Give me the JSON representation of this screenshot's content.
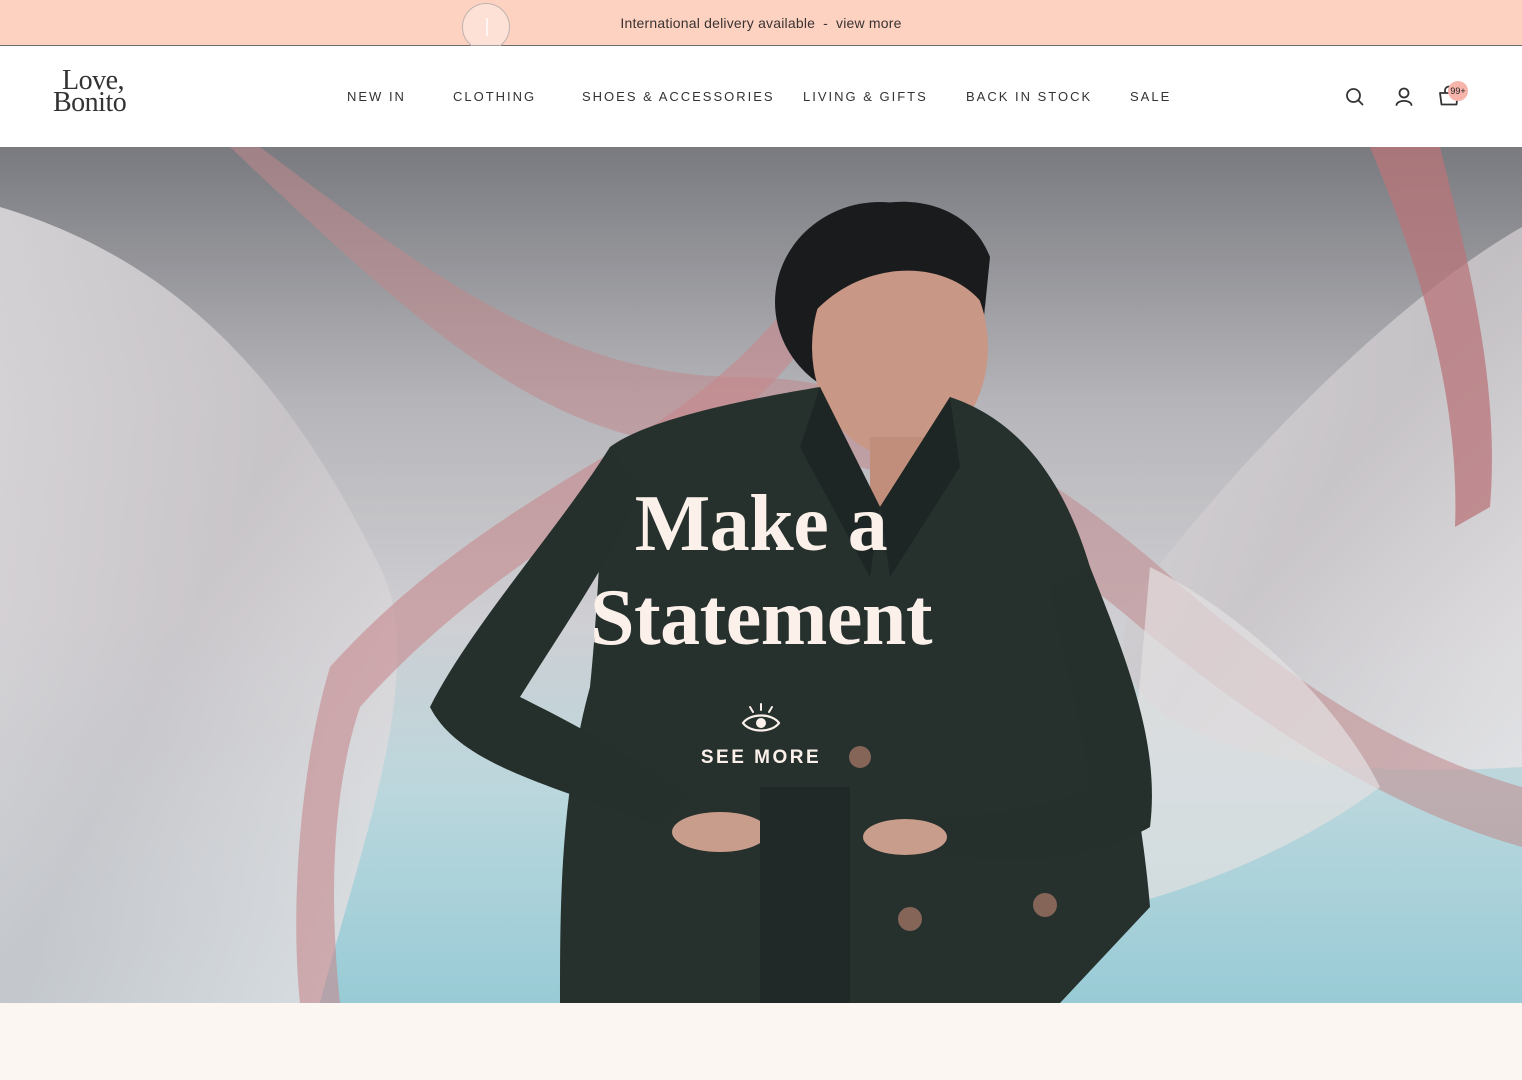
{
  "announcement": {
    "text": "International delivery available",
    "separator": "-",
    "link": "view more"
  },
  "brand": {
    "logo_line1": "Love,",
    "logo_line2": "Bonito"
  },
  "nav": {
    "items": [
      {
        "label": "NEW IN"
      },
      {
        "label": "CLOTHING"
      },
      {
        "label": "SHOES & ACCESSORIES"
      },
      {
        "label": "LIVING & GIFTS"
      },
      {
        "label": "BACK IN STOCK"
      },
      {
        "label": "SALE"
      }
    ]
  },
  "header_icons": {
    "search": "search-icon",
    "account": "user-icon",
    "cart": "shopping-bag-icon",
    "cart_count": "99+"
  },
  "hero": {
    "title_line1": "Make a",
    "title_line2": "Statement",
    "cta_label": "SEE MORE",
    "cta_icon": "eye-icon"
  },
  "colors": {
    "announcement_bg": "#fdd2c0",
    "badge": "#f6b4ab",
    "hero_text": "#fbf1ea",
    "page_bg": "#fbf6f2"
  }
}
